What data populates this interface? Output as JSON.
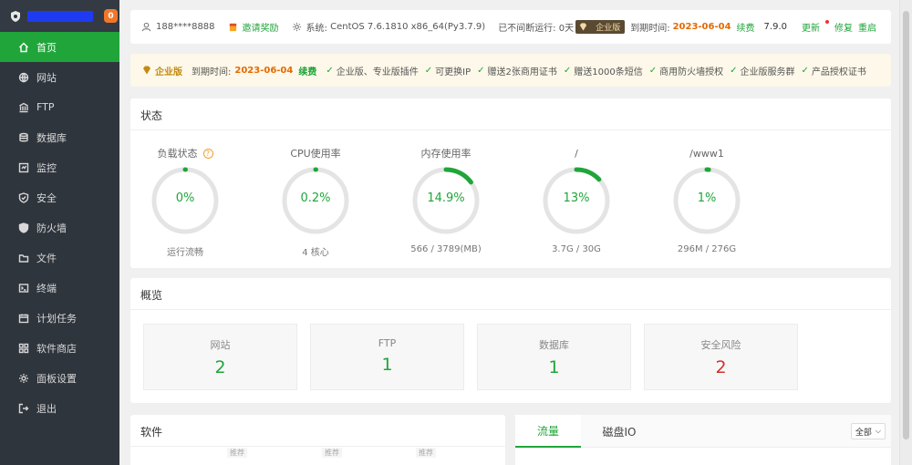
{
  "sidebar": {
    "badge": "0",
    "items": [
      {
        "label": "首页",
        "icon": "home-icon"
      },
      {
        "label": "网站",
        "icon": "globe-icon"
      },
      {
        "label": "FTP",
        "icon": "ftp-icon"
      },
      {
        "label": "数据库",
        "icon": "database-icon"
      },
      {
        "label": "监控",
        "icon": "monitor-icon"
      },
      {
        "label": "安全",
        "icon": "shield-icon"
      },
      {
        "label": "防火墙",
        "icon": "firewall-icon"
      },
      {
        "label": "文件",
        "icon": "folder-icon"
      },
      {
        "label": "终端",
        "icon": "terminal-icon"
      },
      {
        "label": "计划任务",
        "icon": "calendar-icon"
      },
      {
        "label": "软件商店",
        "icon": "apps-icon"
      },
      {
        "label": "面板设置",
        "icon": "gear-icon"
      },
      {
        "label": "退出",
        "icon": "logout-icon"
      }
    ]
  },
  "topbar": {
    "phone": "188****8888",
    "invite": "邀请奖励",
    "system_label": "系统:",
    "system": "CentOS 7.6.1810 x86_64(Py3.7.9)",
    "uptime": "已不间断运行: 0天",
    "edition": "企业版",
    "expire_label": "到期时间:",
    "expire_date": "2023-06-04",
    "renew": "续费",
    "version": "7.9.0",
    "update": "更新",
    "repair": "修复",
    "restart": "重启"
  },
  "enterprise": {
    "label": "企业版",
    "expire_label": "到期时间:",
    "expire_date": "2023-06-04",
    "renew": "续费",
    "features": [
      "企业版、专业版插件",
      "可更换IP",
      "赠送2张商用证书",
      "赠送1000条短信",
      "商用防火墙授权",
      "企业版服务群",
      "产品授权证书"
    ]
  },
  "status": {
    "title": "状态",
    "gauges": [
      {
        "title": "负载状态",
        "value": "0%",
        "sub": "运行流畅",
        "pct": 0.0,
        "help": "?"
      },
      {
        "title": "CPU使用率",
        "value": "0.2%",
        "sub": "4 核心",
        "pct": 0.002
      },
      {
        "title": "内存使用率",
        "value": "14.9%",
        "sub": "566 / 3789(MB)",
        "pct": 0.149
      },
      {
        "title": "/",
        "value": "13%",
        "sub": "3.7G / 30G",
        "pct": 0.13
      },
      {
        "title": "/www1",
        "value": "1%",
        "sub": "296M / 276G",
        "pct": 0.01
      }
    ]
  },
  "overview": {
    "title": "概览",
    "boxes": [
      {
        "label": "网站",
        "value": "2"
      },
      {
        "label": "FTP",
        "value": "1"
      },
      {
        "label": "数据库",
        "value": "1"
      },
      {
        "label": "安全风险",
        "value": "2"
      }
    ]
  },
  "software": {
    "title": "软件",
    "recommend": "推荐"
  },
  "traffic": {
    "tabs": [
      "流量",
      "磁盘IO"
    ],
    "select": "全部"
  },
  "colors": {
    "accent": "#20a53a",
    "sidebar": "#2f353d",
    "danger": "#d0332c",
    "warn": "#e66a00"
  }
}
